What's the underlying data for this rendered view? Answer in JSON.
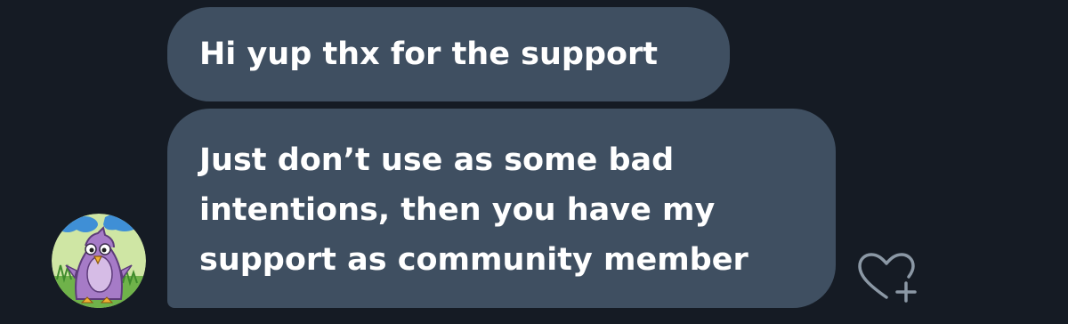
{
  "conversation": {
    "messages": [
      {
        "lines": [
          "Hi yup thx for the support"
        ]
      },
      {
        "lines": [
          "Just don’t use as some bad",
          "intentions, then you have my",
          "support as community member"
        ]
      }
    ],
    "react_icon": "heart-plus-icon",
    "avatar_icon": "purple-bird-avatar"
  },
  "colors": {
    "background": "#151b24",
    "bubble": "#3f4f61",
    "text": "#ffffff",
    "icon": "#8b98a5"
  }
}
